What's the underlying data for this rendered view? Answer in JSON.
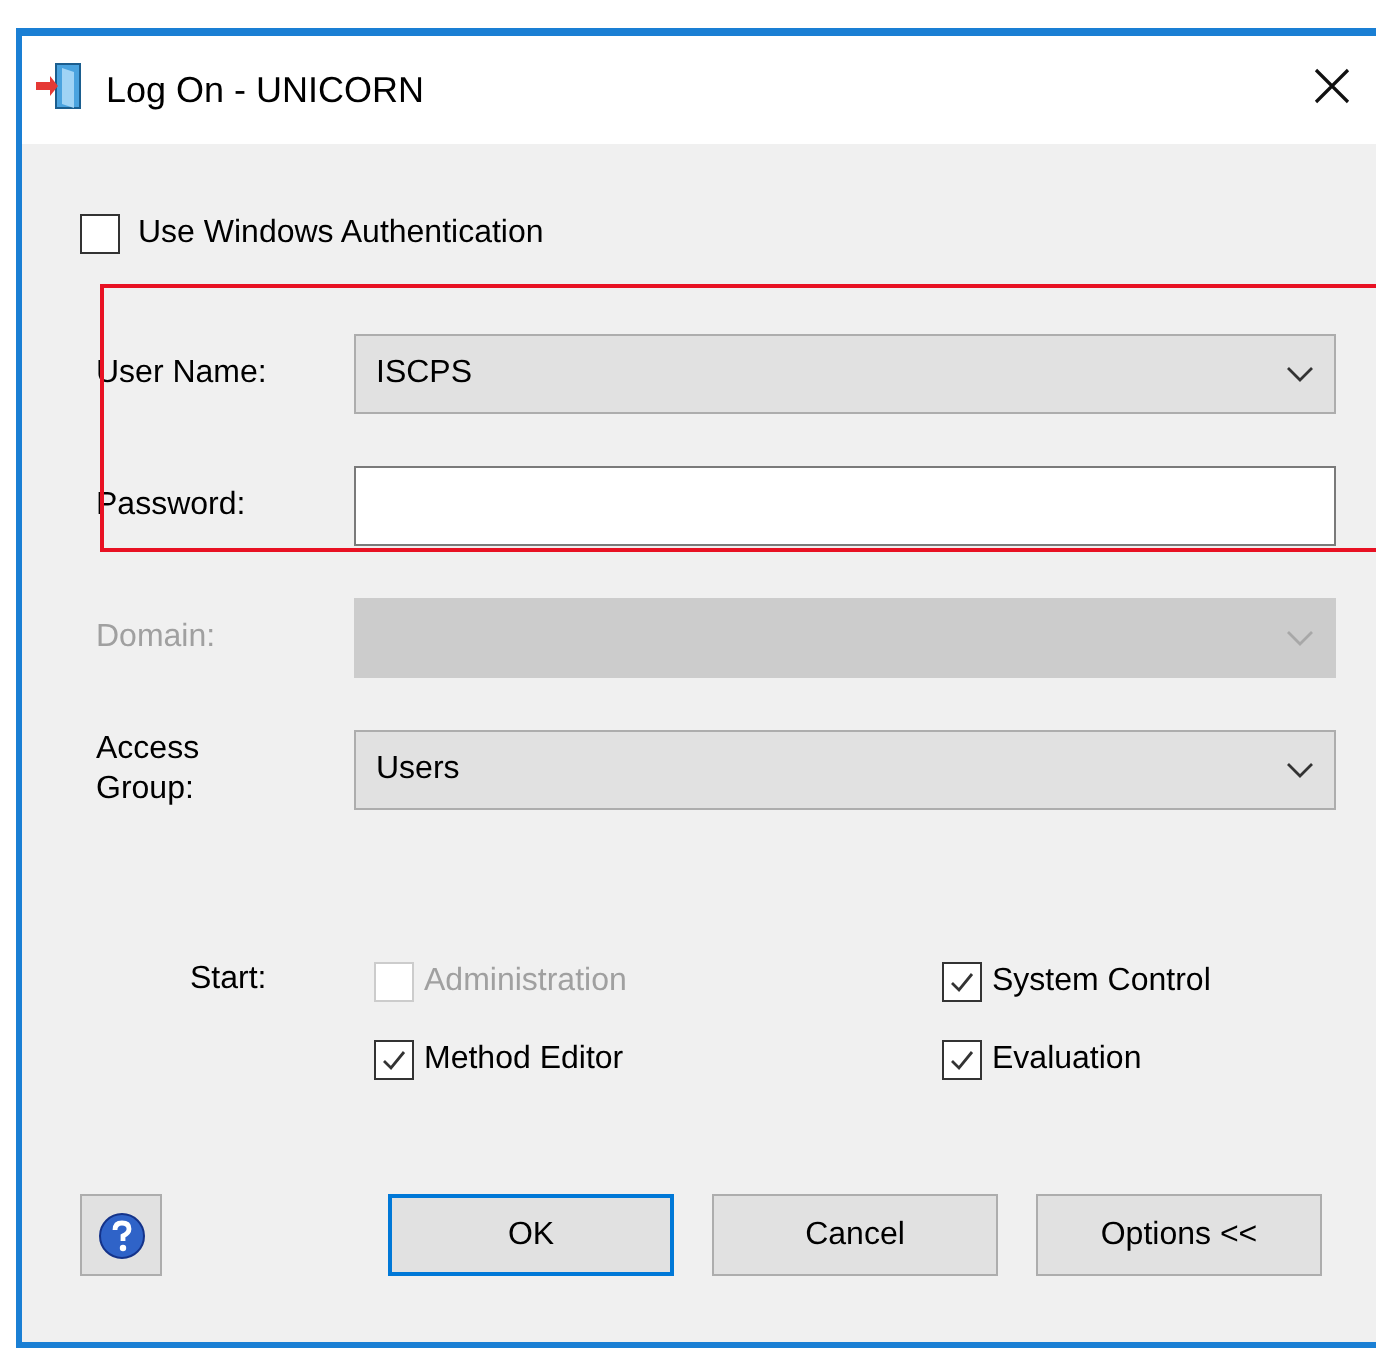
{
  "window": {
    "title": "Log On - UNICORN"
  },
  "use_windows_auth": {
    "label": "Use Windows Authentication",
    "checked": false
  },
  "fields": [
    {
      "kind": "combo",
      "label": "User Name:",
      "value": "ISCPS",
      "disabled": false
    },
    {
      "kind": "text",
      "label": "Password:"
    },
    {
      "kind": "combo",
      "label": "Domain:",
      "disabled": true
    },
    {
      "kind": "combo",
      "label": "Access\nGroup:",
      "value": "Users",
      "disabled": false
    }
  ],
  "start": {
    "label": "Start:",
    "options": [
      {
        "label": "Administration",
        "checked": false,
        "disabled": true
      },
      {
        "label": "System Control",
        "checked": true,
        "disabled": false
      },
      {
        "label": "Method Editor",
        "checked": true,
        "disabled": false
      },
      {
        "label": "Evaluation",
        "checked": true,
        "disabled": false
      }
    ]
  },
  "buttons": [
    {
      "kind": "help",
      "default": false
    },
    {
      "kind": "text",
      "label": "OK",
      "default": true
    },
    {
      "kind": "text",
      "label": "Cancel",
      "default": false
    },
    {
      "kind": "text",
      "label": "Options <<",
      "default": false
    }
  ],
  "highlight_box": true
}
